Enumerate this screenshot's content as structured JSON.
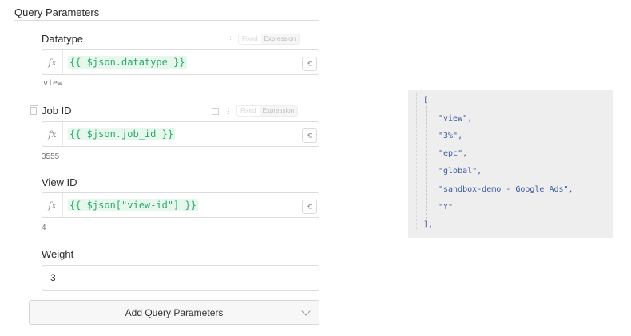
{
  "section": {
    "title": "Query Parameters"
  },
  "toggle": {
    "fixed": "Fixed",
    "expression": "Expression"
  },
  "params": {
    "datatype": {
      "label": "Datatype",
      "expression": "{{ $json.datatype }}",
      "result": "view"
    },
    "job_id": {
      "label": "Job ID",
      "expression": "{{ $json.job_id }}",
      "result": "3555"
    },
    "view_id": {
      "label": "View ID",
      "expression": "{{ $json[\"view-id\"] }}",
      "result": "4"
    },
    "weight": {
      "label": "Weight",
      "value": "3"
    }
  },
  "add_button": {
    "label": "Add Query Parameters"
  },
  "json_preview": {
    "open": "[",
    "items": [
      "\"view\",",
      "\"3%\",",
      "\"epc\",",
      "\"global\",",
      "\"sandbox-demo - Google Ads\",",
      "\"Y\""
    ],
    "close": "],"
  },
  "icons": {
    "fx": "fx",
    "open_editor": "external-link-icon",
    "delete": "trash-icon",
    "more": "more-vertical-icon",
    "chevron": "chevron-down-icon"
  },
  "colors": {
    "expression_text": "#2ea866",
    "expression_bg": "#e6f8ee",
    "json_text": "#3d5a9e",
    "json_bg": "#eeeeee"
  }
}
